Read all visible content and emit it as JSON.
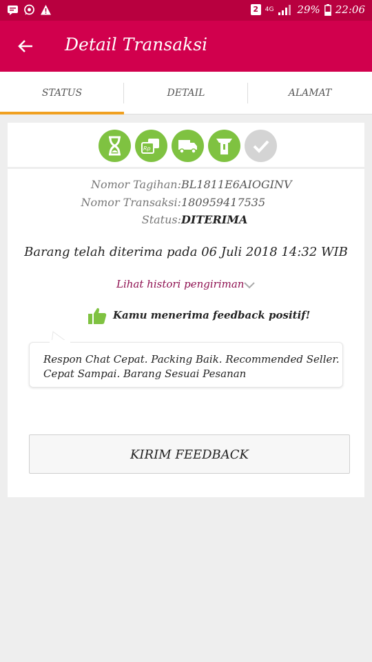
{
  "status_bar": {
    "sim": "2",
    "network": "4G",
    "battery": "29%",
    "time": "22:06"
  },
  "app_bar": {
    "title": "Detail Transaksi"
  },
  "tabs": [
    {
      "label": "STATUS",
      "active": true
    },
    {
      "label": "DETAIL",
      "active": false
    },
    {
      "label": "ALAMAT",
      "active": false
    }
  ],
  "progress_steps": [
    {
      "icon": "hourglass-icon",
      "done": true
    },
    {
      "icon": "payment-icon",
      "done": true
    },
    {
      "icon": "truck-icon",
      "done": true
    },
    {
      "icon": "package-received-icon",
      "done": true
    },
    {
      "icon": "check-icon",
      "done": false
    }
  ],
  "info": {
    "invoice_label": "Nomor Tagihan:",
    "invoice_value": "BL1811E6AIOGINV",
    "transaction_label": "Nomor Transaksi:",
    "transaction_value": "180959417535",
    "status_label": "Status:",
    "status_value": "DITERIMA"
  },
  "received_text": "Barang telah diterima pada 06 Juli 2018 14:32 WIB",
  "history_link": "Lihat histori pengiriman",
  "feedback_message": "Kamu menerima feedback positif!",
  "feedback_text": "Respon Chat Cepat. Packing Baik. Recommended Seller. Cepat Sampai. Barang Sesuai Pesanan",
  "send_feedback_button": "KIRIM FEEDBACK",
  "colors": {
    "status_bar": "#b8003f",
    "app_bar": "#d1004d",
    "tab_indicator": "#f0a020",
    "step_done": "#7fc241",
    "step_pending": "#d4d4d4",
    "link": "#8e1050"
  }
}
